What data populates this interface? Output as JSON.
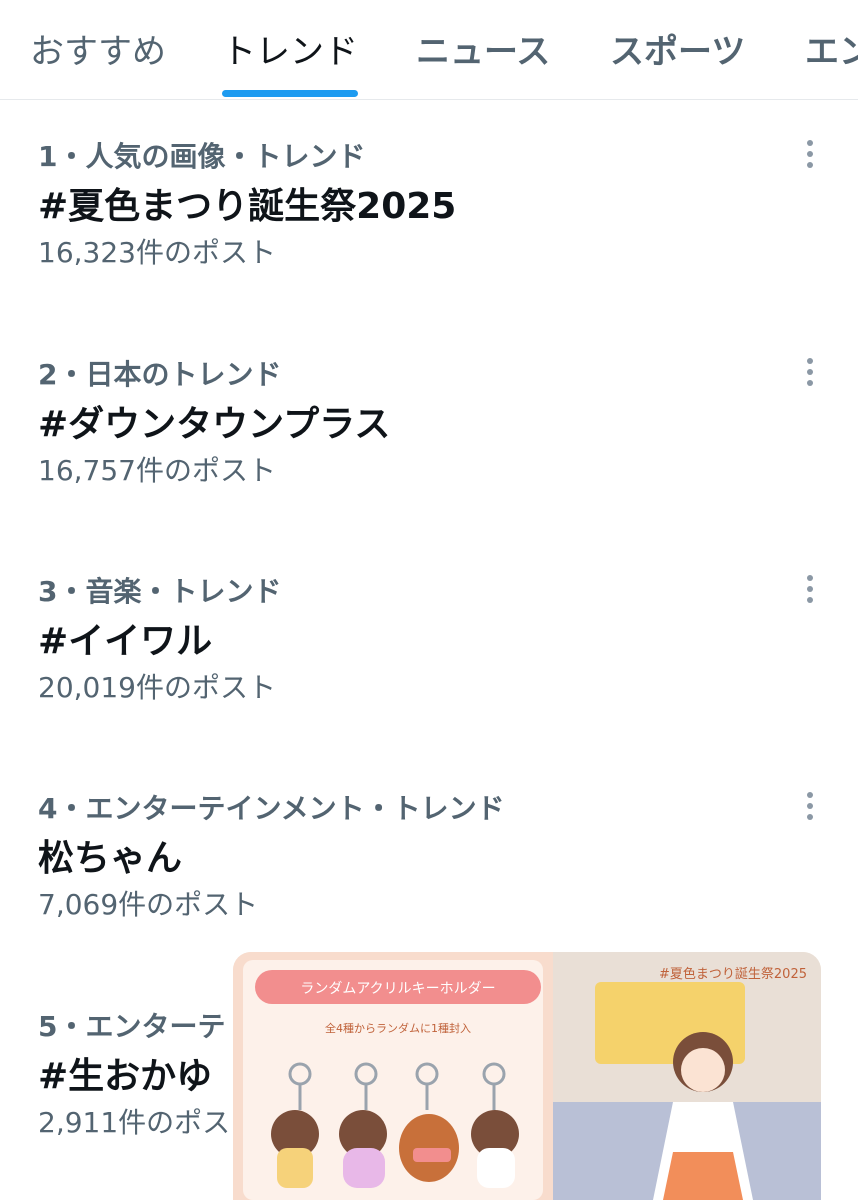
{
  "tabs": [
    {
      "label": "おすすめ"
    },
    {
      "label": "トレンド"
    },
    {
      "label": "ニュース"
    },
    {
      "label": "スポーツ"
    },
    {
      "label": "エン"
    }
  ],
  "trends": [
    {
      "meta": "1・人気の画像・トレンド",
      "name": "#夏色まつり誕生祭2025",
      "count": "16,323件のポスト"
    },
    {
      "meta": "2・日本のトレンド",
      "name": "#ダウンタウンプラス",
      "count": "16,757件のポスト"
    },
    {
      "meta": "3・音楽・トレンド",
      "name": "#イイワル",
      "count": "20,019件のポスト"
    },
    {
      "meta": "4・エンターテインメント・トレンド",
      "name": "松ちゃん",
      "count": "7,069件のポスト"
    },
    {
      "meta": "5・エンターテ",
      "name": "#生おかゆ",
      "count": "2,911件のポス"
    }
  ],
  "media": {
    "banner": "ランダムアクリルキーホルダー",
    "subtitle": "全4種からランダムに1種封入",
    "hashtag": "#夏色まつり誕生祭2025",
    "colors": {
      "bg": "#f7e6d6",
      "panel": "#fdeee4",
      "accent": "#f4a261"
    }
  }
}
